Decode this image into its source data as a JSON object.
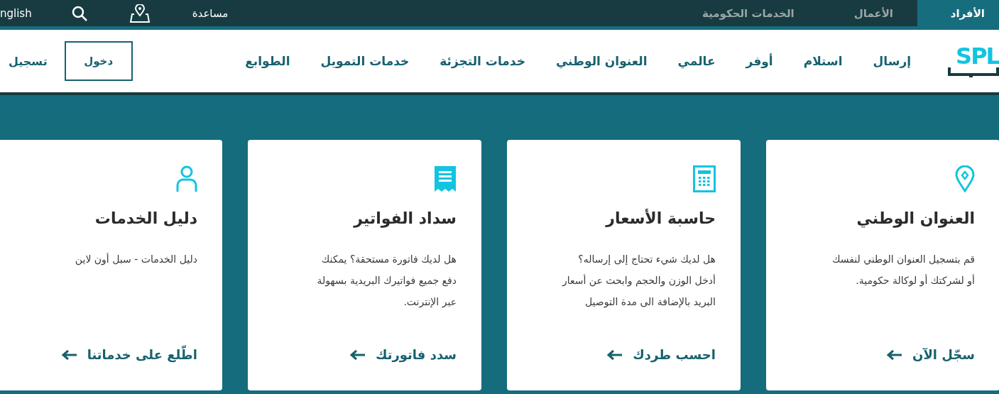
{
  "top_bar": {
    "tabs": [
      {
        "label": "الأفراد",
        "selected": true
      },
      {
        "label": "الأعمال",
        "selected": false
      },
      {
        "label": "الخدمات الحكومية",
        "selected": false
      }
    ],
    "help": "مساعدة",
    "language": "nglish"
  },
  "nav": {
    "logo": "SPL",
    "items": [
      "إرسال",
      "استلام",
      "أوفر",
      "عالمي",
      "العنوان الوطني",
      "خدمات التجزئة",
      "خدمات التمويل",
      "الطوابع"
    ],
    "login": "دخول",
    "register": "تسجيل"
  },
  "cards": [
    {
      "kind": "pin",
      "title": "العنوان الوطني",
      "lines": [
        "قم بتسجيل العنوان الوطني لنفسك",
        "أو لشركتك أو لوكالة حكومية."
      ],
      "link": "سجّل الآن"
    },
    {
      "kind": "calculator",
      "title": "حاسبة الأسعار",
      "lines": [
        "هل لديك شيء تحتاج إلى إرساله؟",
        "أدخل الوزن والحجم وابحث عن أسعار",
        "البريد بالإضافة الى مدة التوصيل"
      ],
      "link": "احسب طردك"
    },
    {
      "kind": "receipt",
      "title": "سداد الفواتير",
      "lines": [
        "هل لديك فاتورة مستحقة؟ يمكنك",
        "دفع جميع فواتيرك البريدية بسهولة",
        "عبر الإنترنت."
      ],
      "link": "سدد فاتورتك"
    },
    {
      "kind": "person",
      "title": "دليل الخدمات",
      "lines": [
        "دليل الخدمات - سبل أون لاين"
      ],
      "link": "اطّلع على خدماتنا"
    }
  ]
}
